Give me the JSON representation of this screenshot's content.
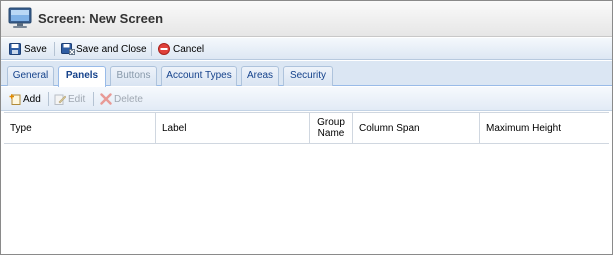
{
  "window": {
    "title": "Screen: New Screen"
  },
  "toolbar": {
    "save_label": "Save",
    "save_close_label": "Save and Close",
    "cancel_label": "Cancel"
  },
  "tabs": [
    {
      "label": "General",
      "active": false
    },
    {
      "label": "Panels",
      "active": true
    },
    {
      "label": "Buttons",
      "active": false
    },
    {
      "label": "Account Types",
      "active": false
    },
    {
      "label": "Areas",
      "active": false
    },
    {
      "label": "Security",
      "active": false
    }
  ],
  "grid_toolbar": {
    "add_label": "Add",
    "edit_label": "Edit",
    "delete_label": "Delete"
  },
  "grid": {
    "columns": [
      "Type",
      "Label",
      "Group Name",
      "Column Span",
      "Maximum Height"
    ],
    "rows": []
  },
  "colors": {
    "accent": "#15428b",
    "tab_bg": "#dbe6f3",
    "toolbar_bg": "#dde7f3"
  }
}
